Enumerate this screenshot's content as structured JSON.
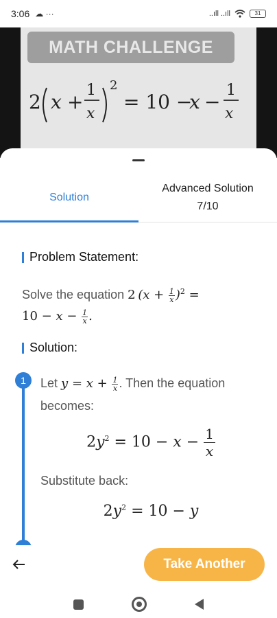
{
  "status_bar": {
    "time": "3:06",
    "left_icons": "☁ ···",
    "signal": "..ıll ..ıll",
    "wifi": "wifi-icon",
    "battery": "31"
  },
  "camera": {
    "banner": "MATH CHALLENGE",
    "equation": "2(x + 1/x)^2 = 10 − x − 1/x"
  },
  "tabs": {
    "solution": "Solution",
    "advanced_line1": "Advanced Solution",
    "advanced_line2": "7/10",
    "active": "solution"
  },
  "problem": {
    "heading": "Problem Statement:",
    "prefix": "Solve the equation"
  },
  "solution": {
    "heading": "Solution:",
    "step1_number": "1",
    "step1_text_a": "Let",
    "step1_text_b": ". Then the equation becomes:",
    "substitute_text": "Substitute back:"
  },
  "actions": {
    "take_another": "Take Another"
  },
  "colors": {
    "accent": "#2f7fd6",
    "button": "#f7b548"
  }
}
